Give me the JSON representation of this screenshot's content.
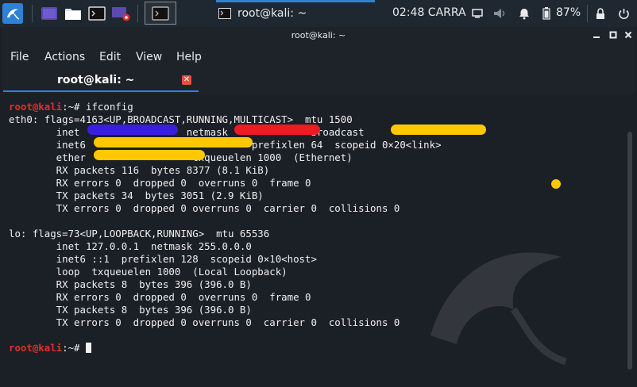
{
  "panel": {
    "task_title": "root@kali: ~",
    "clock": "02:48 CARRA",
    "battery": "87%"
  },
  "window": {
    "title": "root@kali: ~",
    "menu": [
      "File",
      "Actions",
      "Edit",
      "View",
      "Help"
    ],
    "tab_label": "root@kali: ~"
  },
  "terminal": {
    "prompt_user": "root@kali",
    "prompt_path": ":~# ",
    "command": "ifconfig",
    "lines": [
      "eth0: flags=4163<UP,BROADCAST,RUNNING,MULTICAST>  mtu 1500",
      "        inet                  netmask              broadcast",
      "        inet6                            prefixlen 64  scopeid 0×20<link>",
      "        ether                  txqueuelen 1000  (Ethernet)",
      "        RX packets 116  bytes 8377 (8.1 KiB)",
      "        RX errors 0  dropped 0  overruns 0  frame 0",
      "        TX packets 34  bytes 3051 (2.9 KiB)",
      "        TX errors 0  dropped 0 overruns 0  carrier 0  collisions 0",
      "",
      "lo: flags=73<UP,LOOPBACK,RUNNING>  mtu 65536",
      "        inet 127.0.0.1  netmask 255.0.0.0",
      "        inet6 ::1  prefixlen 128  scopeid 0×10<host>",
      "        loop  txqueuelen 1000  (Local Loopback)",
      "        RX packets 8  bytes 396 (396.0 B)",
      "        RX errors 0  dropped 0  overruns 0  frame 0",
      "        TX packets 8  bytes 396 (396.0 B)",
      "        TX errors 0  dropped 0 overruns 0  carrier 0  collisions 0",
      ""
    ]
  },
  "colors": {
    "prompt": "#e0302f",
    "redaction_blue": "#3a1ee0",
    "redaction_red": "#ec1b24",
    "redaction_yellow": "#ffc800",
    "accent": "#2d82d7"
  }
}
